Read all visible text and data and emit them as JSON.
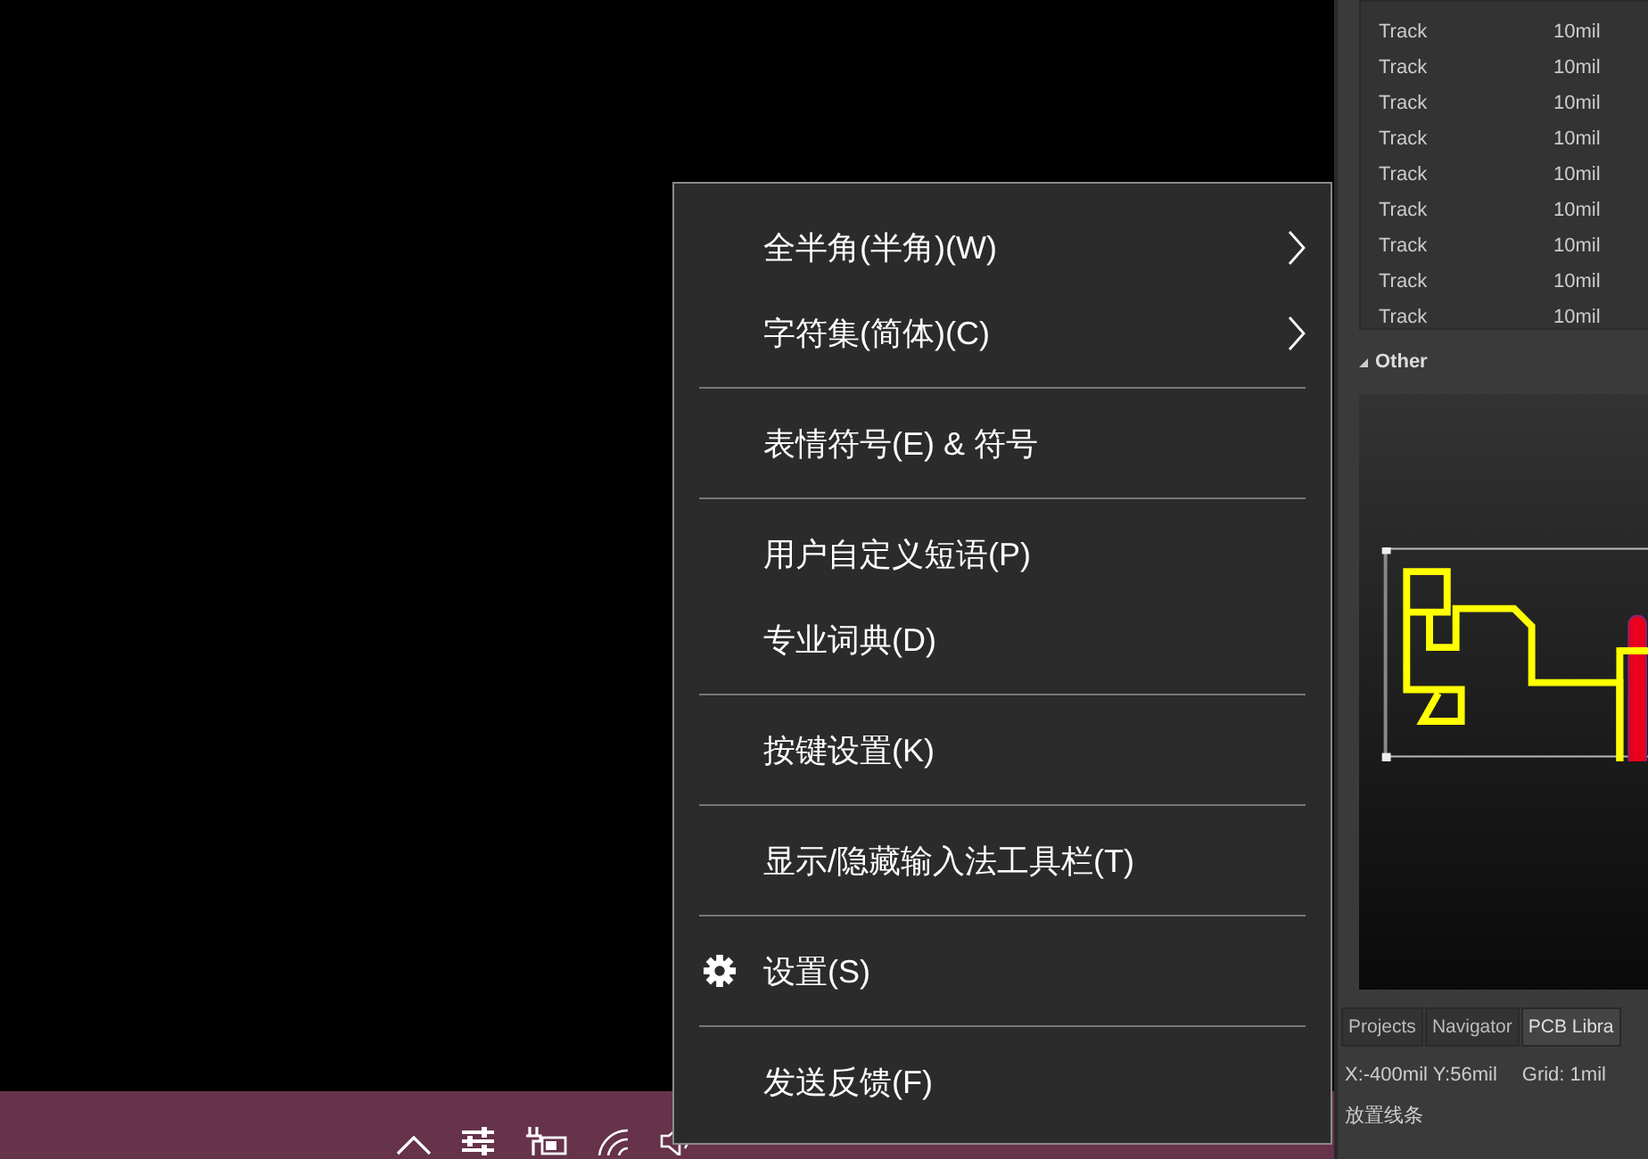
{
  "menu": {
    "groups": [
      [
        {
          "label": "全半角(半角)(W)",
          "kind": "plain",
          "submenu": true
        },
        {
          "label": "字符集(简体)(C)",
          "kind": "plain",
          "submenu": true
        }
      ],
      [
        {
          "label": "表情符号(E) & 符号",
          "kind": "plain",
          "submenu": false
        }
      ],
      [
        {
          "label": "用户自定义短语(P)",
          "kind": "plain",
          "submenu": false
        },
        {
          "label": "专业词典(D)",
          "kind": "plain",
          "submenu": false
        }
      ],
      [
        {
          "label": "按键设置(K)",
          "kind": "plain",
          "submenu": false
        }
      ],
      [
        {
          "label": "显示/隐藏输入法工具栏(T)",
          "kind": "plain",
          "submenu": false
        }
      ],
      [
        {
          "label": "设置(S)",
          "kind": "settings",
          "submenu": false
        }
      ],
      [
        {
          "label": "发送反馈(F)",
          "kind": "plain",
          "submenu": false
        }
      ]
    ]
  },
  "panel": {
    "rows": [
      {
        "object": "Track",
        "width": "10mil"
      },
      {
        "object": "Track",
        "width": "10mil"
      },
      {
        "object": "Track",
        "width": "10mil"
      },
      {
        "object": "Track",
        "width": "10mil"
      },
      {
        "object": "Track",
        "width": "10mil"
      },
      {
        "object": "Track",
        "width": "10mil"
      },
      {
        "object": "Track",
        "width": "10mil"
      },
      {
        "object": "Track",
        "width": "10mil"
      },
      {
        "object": "Track",
        "width": "10mil"
      }
    ],
    "section": "Other",
    "tabs": [
      {
        "label": "Projects",
        "selected": false
      },
      {
        "label": "Navigator",
        "selected": false
      },
      {
        "label": "PCB Libra",
        "selected": true
      }
    ],
    "coords": "X:-400mil Y:56mil",
    "grid": "Grid: 1mil",
    "hint": "放置线条"
  }
}
